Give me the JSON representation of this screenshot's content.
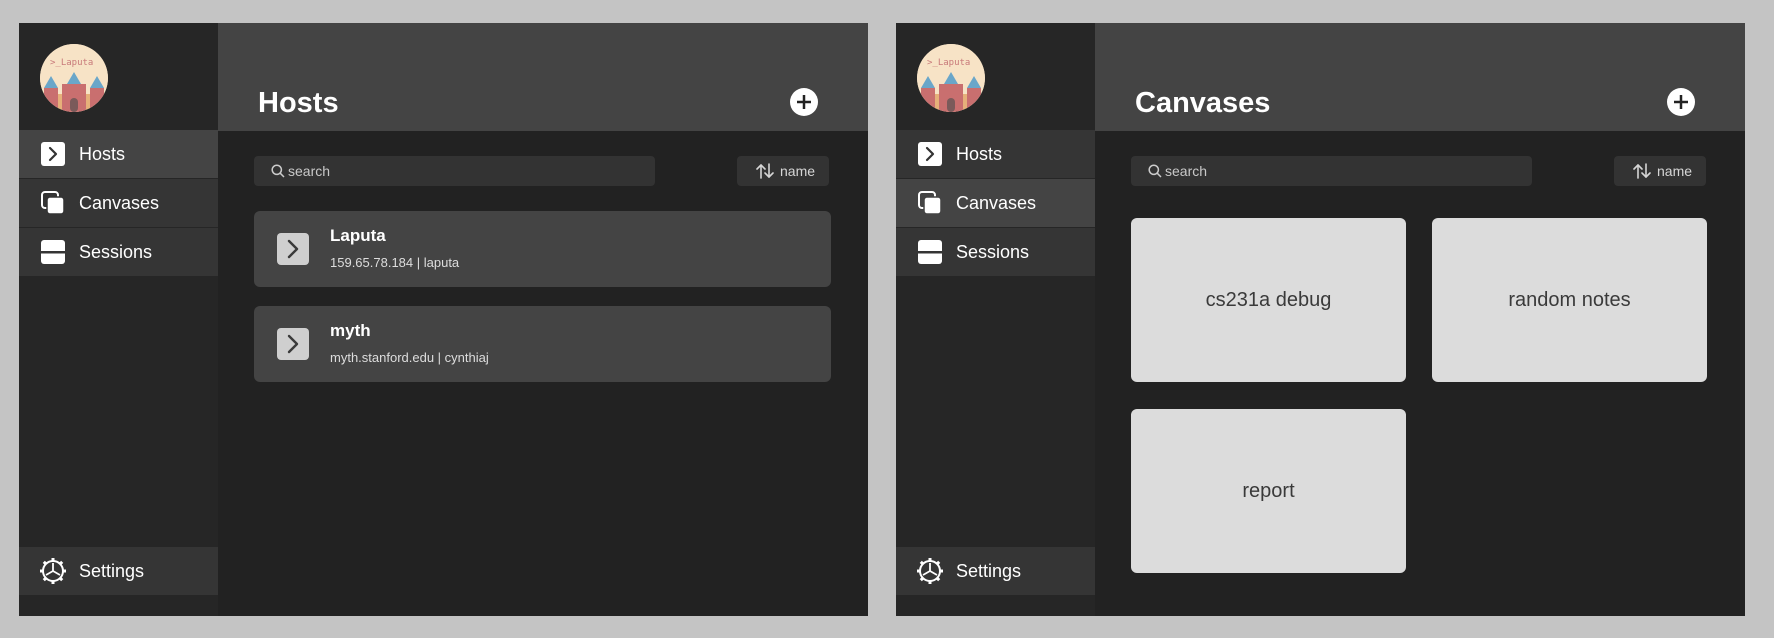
{
  "panels": [
    {
      "logo_text": ">_Laputa",
      "sidebar": {
        "items": [
          {
            "label": "Hosts",
            "icon": "chevron-right-icon"
          },
          {
            "label": "Canvases",
            "icon": "stacked-squares-icon"
          },
          {
            "label": "Sessions",
            "icon": "split-rectangle-icon"
          }
        ],
        "active": "Hosts",
        "settings_label": "Settings",
        "settings_icon": "gear-icon"
      },
      "header": {
        "title": "Hosts",
        "add_icon": "plus-icon"
      },
      "search": {
        "placeholder": "search"
      },
      "sort": {
        "label": "name",
        "icon": "sort-arrows-icon"
      },
      "hosts": [
        {
          "name": "Laputa",
          "detail": "159.65.78.184 | laputa"
        },
        {
          "name": "myth",
          "detail": "myth.stanford.edu | cynthiaj"
        }
      ]
    },
    {
      "logo_text": ">_Laputa",
      "sidebar": {
        "items": [
          {
            "label": "Hosts",
            "icon": "chevron-right-icon"
          },
          {
            "label": "Canvases",
            "icon": "stacked-squares-icon"
          },
          {
            "label": "Sessions",
            "icon": "split-rectangle-icon"
          }
        ],
        "active": "Canvases",
        "settings_label": "Settings",
        "settings_icon": "gear-icon"
      },
      "header": {
        "title": "Canvases",
        "add_icon": "plus-icon"
      },
      "search": {
        "placeholder": "search"
      },
      "sort": {
        "label": "name",
        "icon": "sort-arrows-icon"
      },
      "canvases": [
        {
          "label": "cs231a debug"
        },
        {
          "label": "random notes"
        },
        {
          "label": "report"
        }
      ]
    }
  ],
  "colors": {
    "page_background": "#c4c4c4",
    "content_background": "#222222",
    "sidebar_background": "#262626",
    "nav_item": "#353535",
    "nav_item_active": "#444444",
    "header_background": "#444444",
    "card_background": "#444444",
    "canvas_card": "#dcdcdc"
  }
}
